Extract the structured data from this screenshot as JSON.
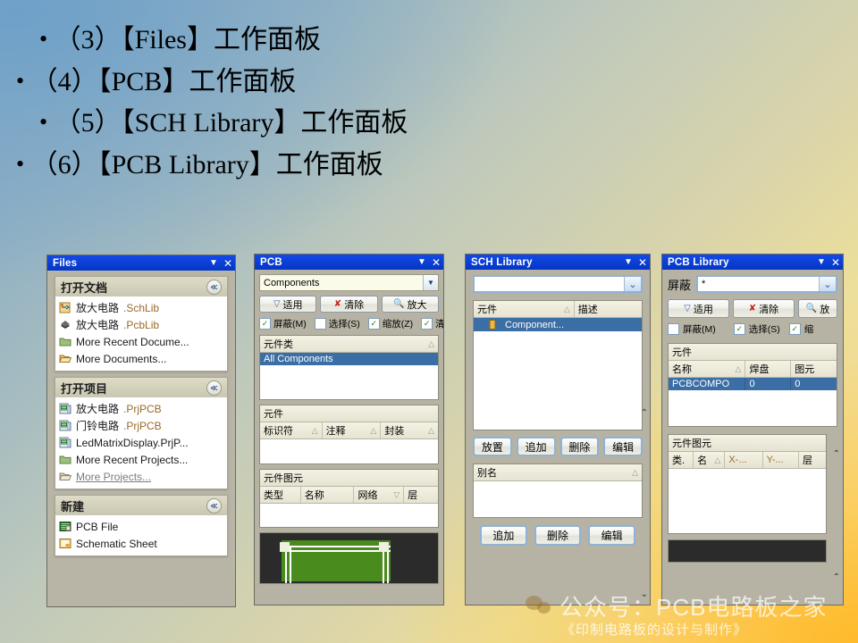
{
  "slide": {
    "bullets": [
      {
        "bullet": "•",
        "text": "（3）【Files】工作面板"
      },
      {
        "bullet": "•",
        "text": "（4）【PCB】工作面板"
      },
      {
        "bullet": "•",
        "text": "（5）【SCH Library】工作面板"
      },
      {
        "bullet": "•",
        "text": "（6）【PCB Library】工作面板"
      }
    ],
    "watermark": {
      "account": "公众号：PCB电路板之家",
      "book": "《印制电路板的设计与制作》"
    }
  },
  "files_panel": {
    "title": "Files",
    "collapse_icon": "▼",
    "close_icon": "✕",
    "groups": [
      {
        "header": "打开文档",
        "chevron": "≪",
        "items": [
          {
            "icon": "schlib-icon",
            "name": "放大电路",
            "ext": ".SchLib",
            "dim": false
          },
          {
            "icon": "pcblib-icon",
            "name": "放大电路",
            "ext": ".PcbLib",
            "dim": false
          },
          {
            "icon": "folder-icon",
            "name": "More Recent Docume...",
            "ext": "",
            "dim": false
          },
          {
            "icon": "open-folder-icon",
            "name": "More Documents...",
            "ext": "",
            "dim": false
          }
        ]
      },
      {
        "header": "打开项目",
        "chevron": "≪",
        "items": [
          {
            "icon": "prjpcb-icon",
            "name": "放大电路",
            "ext": ".PrjPCB",
            "dim": false
          },
          {
            "icon": "prjpcb-icon",
            "name": "门铃电路",
            "ext": ".PrjPCB",
            "dim": false
          },
          {
            "icon": "prjpcb-icon",
            "name": "LedMatrixDisplay.PrjP...",
            "ext": "",
            "dim": false
          },
          {
            "icon": "folder-icon",
            "name": "More Recent Projects...",
            "ext": "",
            "dim": false
          },
          {
            "icon": "open-folder-icon",
            "name": "More Projects...",
            "ext": "",
            "dim": true
          }
        ]
      },
      {
        "header": "新建",
        "chevron": "≪",
        "items": [
          {
            "icon": "pcb-file-icon",
            "name": "PCB File",
            "ext": "",
            "dim": false
          },
          {
            "icon": "sch-sheet-icon",
            "name": "Schematic Sheet",
            "ext": "",
            "dim": false
          }
        ]
      }
    ]
  },
  "pcb_panel": {
    "title": "PCB",
    "collapse_icon": "▼",
    "close_icon": "✕",
    "combo_value": "Components",
    "combo_arrow": "▼",
    "buttons": [
      {
        "glyph": "filter-icon",
        "label": "适用"
      },
      {
        "glyph": "clear-filter-icon",
        "label": "清除"
      },
      {
        "glyph": "zoom-icon",
        "label": "放大"
      }
    ],
    "checkboxes": [
      {
        "label": "屏蔽(M)",
        "checked": true
      },
      {
        "label": "选择(S)",
        "checked": false
      },
      {
        "label": "缩放(Z)",
        "checked": true
      },
      {
        "label": "清",
        "checked": true
      }
    ],
    "class_list": {
      "caption": "元件类",
      "sort": "△",
      "selected_row": "All Components"
    },
    "component_grid": {
      "caption": "元件",
      "columns": [
        "标识符",
        "注释",
        "封装"
      ],
      "sorts": [
        "△",
        "△",
        "△"
      ],
      "rows": []
    },
    "primitive_grid": {
      "caption": "元件图元",
      "columns": [
        "类型",
        "名称",
        "网络",
        "层"
      ],
      "sorts": [
        "",
        "",
        "▽",
        ""
      ],
      "rows": []
    }
  },
  "sch_library_panel": {
    "title": "SCH Library",
    "collapse_icon": "▼",
    "close_icon": "✕",
    "combo_value": "",
    "combo_arrow": "⌄",
    "component_grid": {
      "columns": [
        "元件",
        "描述"
      ],
      "sort": "△",
      "selected_row": "Component..."
    },
    "buttons_row1": [
      "放置",
      "追加",
      "删除",
      "编辑"
    ],
    "alias_grid": {
      "caption": "别名",
      "sort": "△",
      "rows": []
    },
    "buttons_row2": [
      "追加",
      "删除",
      "编辑"
    ],
    "scroll_up": "⌃",
    "scroll_down": "⌄"
  },
  "pcb_library_panel": {
    "title": "PCB Library",
    "collapse_icon": "▼",
    "close_icon": "✕",
    "mask_label": "屏蔽",
    "mask_value": "*",
    "combo_arrow": "⌄",
    "buttons": [
      {
        "glyph": "filter-icon",
        "label": "适用"
      },
      {
        "glyph": "clear-filter-icon",
        "label": "清除"
      },
      {
        "glyph": "zoom-icon",
        "label": "放"
      }
    ],
    "checkboxes": [
      {
        "label": "屏蔽(M)",
        "checked": false
      },
      {
        "label": "选择(S)",
        "checked": true
      },
      {
        "label": "缩",
        "checked": true
      }
    ],
    "component_grid": {
      "caption": "元件",
      "columns": [
        "名称",
        "焊盘",
        "图元"
      ],
      "sort": "△",
      "selected_row": [
        "PCBCOMPO",
        "0",
        "0"
      ]
    },
    "primitive_grid": {
      "caption": "元件图元",
      "columns": [
        "类.",
        "名",
        "X-...",
        "Y-...",
        "层"
      ],
      "sort": "△",
      "rows": []
    },
    "scroll_up": "⌃"
  },
  "colors": {
    "titlebar": "#0a3fd8",
    "selection": "#3a6ea5",
    "panel_bg": "#b6b3a4",
    "board_green": "#4a8b1e"
  }
}
